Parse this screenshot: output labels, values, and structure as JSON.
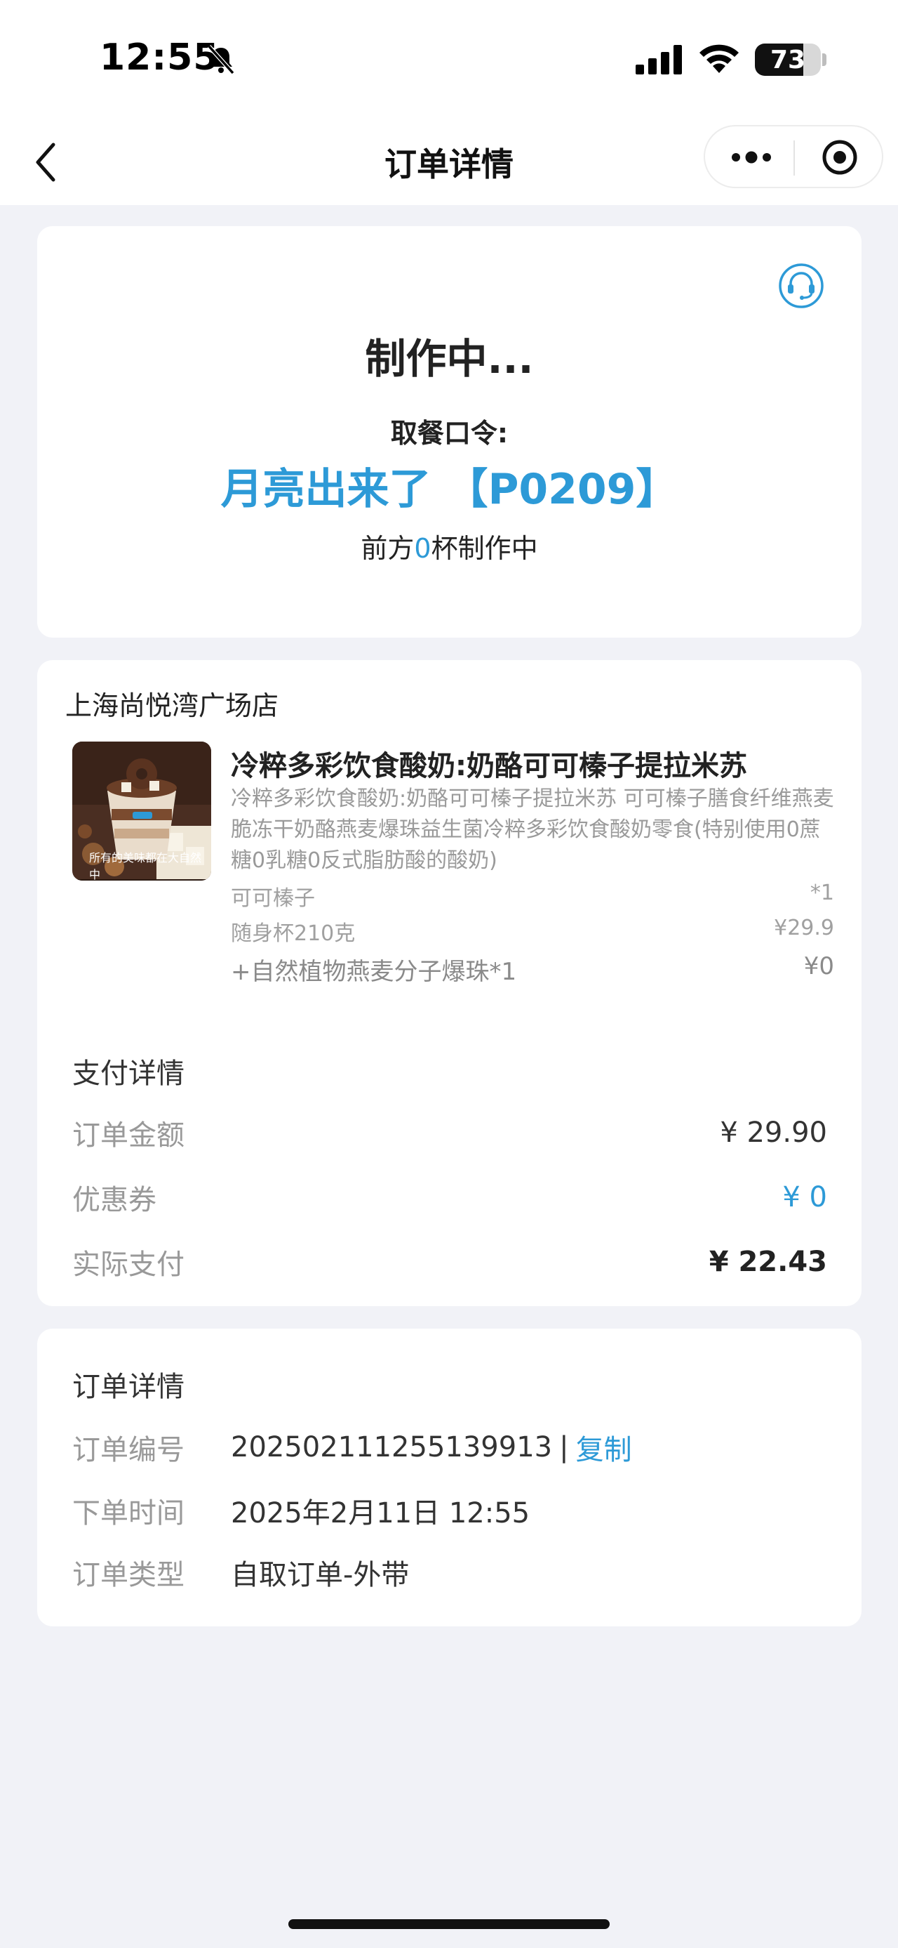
{
  "status_bar": {
    "time": "12:55",
    "battery": "73",
    "battery_level": 0.73
  },
  "nav": {
    "title": "订单详情"
  },
  "status_card": {
    "title": "制作中...",
    "pickup_label": "取餐口令:",
    "pickup_code": "月亮出来了 【P0209】",
    "queue_prefix": "前方",
    "queue_count": "0",
    "queue_suffix": "杯制作中"
  },
  "order": {
    "store_name": "上海尚悦湾广场店",
    "product": {
      "name": "冷粹多彩饮食酸奶:奶酪可可榛子提拉米苏",
      "description": "冷粹多彩饮食酸奶:奶酪可可榛子提拉米苏 可可榛子膳食纤维燕麦脆冻干奶酪燕麦爆珠益生菌冷粹多彩饮食酸奶零食(特别使用0蔗糖0乳糖0反式脂肪酸的酸奶)",
      "image_caption": "所有的美味都在大自然中",
      "specs": [
        {
          "label": "可可榛子",
          "value": "*1"
        },
        {
          "label": "随身杯210克",
          "value": "¥29.9"
        }
      ],
      "addon": {
        "label": "+自然植物燕麦分子爆珠*1",
        "value": "¥0"
      }
    },
    "payment": {
      "title": "支付详情",
      "rows": [
        {
          "label": "订单金额",
          "value": "¥ 29.90"
        },
        {
          "label": "优惠券",
          "value": "¥ 0"
        },
        {
          "label": "实际支付",
          "value": "¥ 22.43"
        }
      ]
    }
  },
  "details": {
    "title": "订单详情",
    "order_no_label": "订单编号",
    "order_no": "202502111255139913",
    "separator": "|",
    "copy_label": "复制",
    "time_label": "下单时间",
    "time_value": "2025年2月11日 12:55",
    "type_label": "订单类型",
    "type_value": "自取订单-外带"
  },
  "colors": {
    "accent": "#2d9ad7",
    "background": "#f1f2f7",
    "card": "#ffffff"
  },
  "icons": [
    "bell-off-icon",
    "signal-icon",
    "wifi-icon",
    "battery-icon",
    "back-arrow-icon",
    "more-dots-icon",
    "close-circle-icon",
    "headset-icon"
  ]
}
